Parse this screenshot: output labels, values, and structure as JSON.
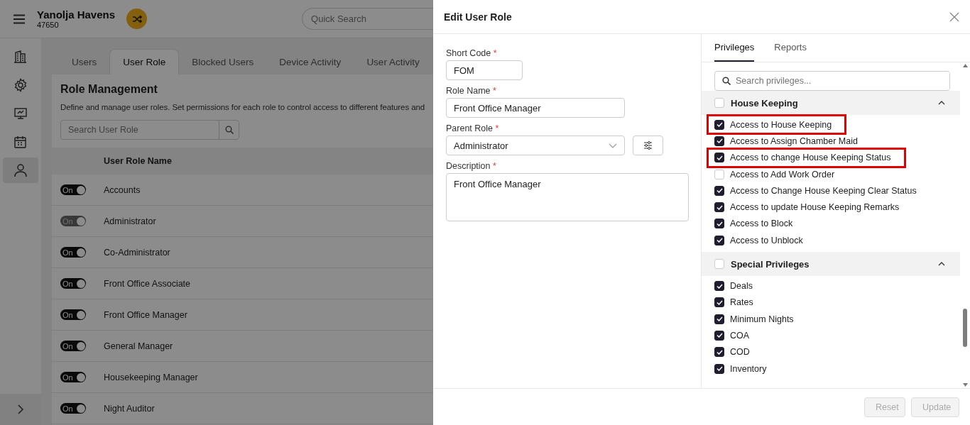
{
  "app": {
    "property_name": "Yanolja Havens",
    "property_id": "47650",
    "quick_search": {
      "placeholder": "Quick Search"
    },
    "sidebar": {
      "items": [
        {
          "selected": false
        },
        {
          "selected": false
        },
        {
          "selected": false
        },
        {
          "selected": false
        },
        {
          "selected": true
        }
      ]
    },
    "tabs": [
      {
        "label": "Users",
        "selected": false
      },
      {
        "label": "User Role",
        "selected": true
      },
      {
        "label": "Blocked Users",
        "selected": false
      },
      {
        "label": "Device Activity",
        "selected": false
      },
      {
        "label": "User Activity",
        "selected": false
      }
    ],
    "page": {
      "title": "Role Management",
      "description": "Define and manage user roles. Set permissions for each role to control access to different features and",
      "search": {
        "placeholder": "Search User Role"
      }
    },
    "table": {
      "columns": [
        "User Role Name"
      ],
      "rows": [
        {
          "name": "Accounts",
          "on": true,
          "disabled": false,
          "toggle_label": "On"
        },
        {
          "name": "Administrator",
          "on": true,
          "disabled": true,
          "toggle_label": "On"
        },
        {
          "name": "Co-Administrator",
          "on": true,
          "disabled": false,
          "toggle_label": "On"
        },
        {
          "name": "Front Office Associate",
          "on": true,
          "disabled": false,
          "toggle_label": "On"
        },
        {
          "name": "Front Office Manager",
          "on": true,
          "disabled": false,
          "toggle_label": "On"
        },
        {
          "name": "General Manager",
          "on": true,
          "disabled": false,
          "toggle_label": "On"
        },
        {
          "name": "Housekeeping Manager",
          "on": true,
          "disabled": false,
          "toggle_label": "On"
        },
        {
          "name": "Night Auditor",
          "on": true,
          "disabled": false,
          "toggle_label": "On"
        }
      ]
    }
  },
  "dialog": {
    "title": "Edit User Role",
    "fields": [
      {
        "kind": "text",
        "label": "Short Code",
        "required_mark": "*",
        "value": "FOM"
      },
      {
        "kind": "text",
        "label": "Role Name",
        "required_mark": "*",
        "value": "Front Office Manager"
      },
      {
        "kind": "select",
        "label": "Parent Role",
        "required_mark": "*",
        "value": "Administrator"
      },
      {
        "kind": "textarea",
        "label": "Description",
        "required_mark": "*",
        "value": "Front Office Manager"
      }
    ],
    "panel_tabs": [
      {
        "label": "Privileges",
        "selected": true
      },
      {
        "label": "Reports",
        "selected": false
      }
    ],
    "privilege_search": {
      "placeholder": "Search privileges..."
    },
    "groups": [
      {
        "name": "House Keeping",
        "checked": false,
        "expanded": true,
        "items": [
          {
            "label": "Access to House Keeping",
            "checked": true,
            "highlighted": true
          },
          {
            "label": "Access to Assign Chamber Maid",
            "checked": true,
            "highlighted": false
          },
          {
            "label": "Access to change House Keeping Status",
            "checked": true,
            "highlighted": true
          },
          {
            "label": "Access to Add Work Order",
            "checked": false,
            "highlighted": false
          },
          {
            "label": "Access to Change House Keeping Clear Status",
            "checked": true,
            "highlighted": false
          },
          {
            "label": "Access to update House Keeping Remarks",
            "checked": true,
            "highlighted": false
          },
          {
            "label": "Access to Block",
            "checked": true,
            "highlighted": false
          },
          {
            "label": "Access to Unblock",
            "checked": true,
            "highlighted": false
          }
        ]
      },
      {
        "name": "Special Privileges",
        "checked": false,
        "expanded": true,
        "items": [
          {
            "label": "Deals",
            "checked": true,
            "highlighted": false
          },
          {
            "label": "Rates",
            "checked": true,
            "highlighted": false
          },
          {
            "label": "Minimum Nights",
            "checked": true,
            "highlighted": false
          },
          {
            "label": "COA",
            "checked": true,
            "highlighted": false
          },
          {
            "label": "COD",
            "checked": true,
            "highlighted": false
          },
          {
            "label": "Inventory",
            "checked": true,
            "highlighted": false
          }
        ]
      }
    ],
    "buttons": [
      {
        "label": "Reset",
        "disabled": true
      },
      {
        "label": "Update",
        "disabled": true
      }
    ]
  }
}
